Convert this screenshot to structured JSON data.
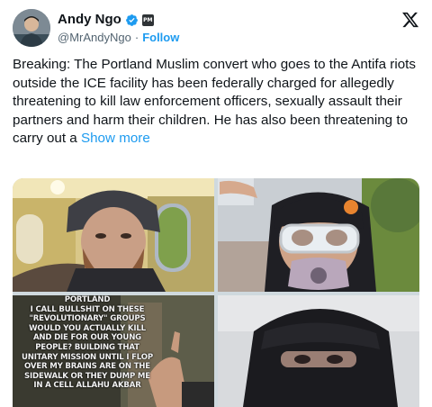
{
  "tweet": {
    "author": {
      "display_name": "Andy Ngo",
      "handle": "@MrAndyNgo",
      "verified": true,
      "affiliate_badge": "PM"
    },
    "separator": "·",
    "follow_label": "Follow",
    "logo_icon": "x-logo-icon",
    "text": "Breaking: The Portland Muslim convert who goes to the Antifa riots outside the ICE facility has been federally charged for allegedly threatening to kill law enforcement officers, sexually assault their partners and harm their children. He has also been threatening to carry out a",
    "show_more_label": "Show more",
    "media": {
      "count": 4,
      "overlay_caption_lines": [
        "PORTLAND",
        "I CALL BULLSHIT ON THESE",
        "\"REVOLUTIONARY\" GROUPS",
        "WOULD YOU ACTUALLY KILL",
        "AND DIE FOR OUR YOUNG",
        "PEOPLE? BUILDING THAT",
        "UNITARY MISSION UNTIL I FLOP",
        "OVER MY BRAINS ARE ON THE",
        "SIDEWALK OR THEY DUMP ME",
        "IN A CELL ALLAHU AKBAR"
      ]
    }
  },
  "colors": {
    "accent": "#1d9bf0",
    "text_primary": "#0f1419",
    "text_secondary": "#536471"
  }
}
